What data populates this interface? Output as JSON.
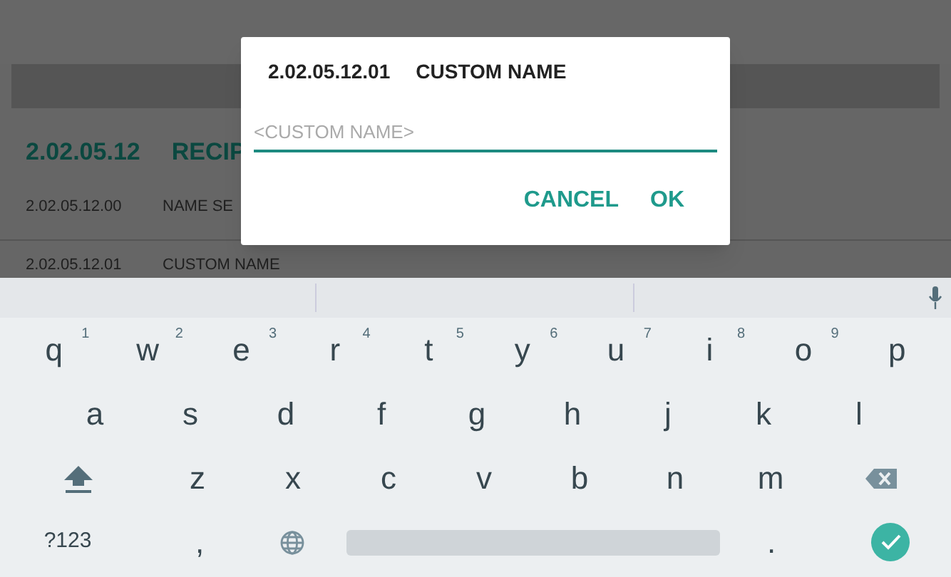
{
  "background": {
    "section": {
      "number": "2.02.05.12",
      "title": "RECIP"
    },
    "rows": [
      {
        "number": "2.02.05.12.00",
        "name": "NAME SE"
      },
      {
        "number": "2.02.05.12.01",
        "name": "CUSTOM NAME"
      }
    ]
  },
  "dialog": {
    "number": "2.02.05.12.01",
    "title": "CUSTOM NAME",
    "field": {
      "placeholder": "<CUSTOM NAME>"
    },
    "buttons": [
      "CANCEL",
      "OK"
    ]
  },
  "keyboard": {
    "rows": [
      [
        {
          "kind": "letter",
          "label": "q",
          "hint": "1"
        },
        {
          "kind": "letter",
          "label": "w",
          "hint": "2"
        },
        {
          "kind": "letter",
          "label": "e",
          "hint": "3"
        },
        {
          "kind": "letter",
          "label": "r",
          "hint": "4"
        },
        {
          "kind": "letter",
          "label": "t",
          "hint": "5"
        },
        {
          "kind": "letter",
          "label": "y",
          "hint": "6"
        },
        {
          "kind": "letter",
          "label": "u",
          "hint": "7"
        },
        {
          "kind": "letter",
          "label": "i",
          "hint": "8"
        },
        {
          "kind": "letter",
          "label": "o",
          "hint": "9"
        },
        {
          "kind": "letter",
          "label": "p"
        }
      ],
      [
        {
          "kind": "letter",
          "label": "a"
        },
        {
          "kind": "letter",
          "label": "s"
        },
        {
          "kind": "letter",
          "label": "d"
        },
        {
          "kind": "letter",
          "label": "f"
        },
        {
          "kind": "letter",
          "label": "g"
        },
        {
          "kind": "letter",
          "label": "h"
        },
        {
          "kind": "letter",
          "label": "j"
        },
        {
          "kind": "letter",
          "label": "k"
        },
        {
          "kind": "letter",
          "label": "l"
        }
      ],
      [
        {
          "kind": "shift"
        },
        {
          "kind": "letter",
          "label": "z"
        },
        {
          "kind": "letter",
          "label": "x"
        },
        {
          "kind": "letter",
          "label": "c"
        },
        {
          "kind": "letter",
          "label": "v"
        },
        {
          "kind": "letter",
          "label": "b"
        },
        {
          "kind": "letter",
          "label": "n"
        },
        {
          "kind": "letter",
          "label": "m"
        },
        {
          "kind": "backspace"
        }
      ],
      [
        {
          "kind": "symbols",
          "label": "?123"
        },
        {
          "kind": "letter",
          "label": ","
        },
        {
          "kind": "globe"
        },
        {
          "kind": "space"
        },
        {
          "kind": "letter",
          "label": "."
        },
        {
          "kind": "enter"
        }
      ]
    ]
  }
}
